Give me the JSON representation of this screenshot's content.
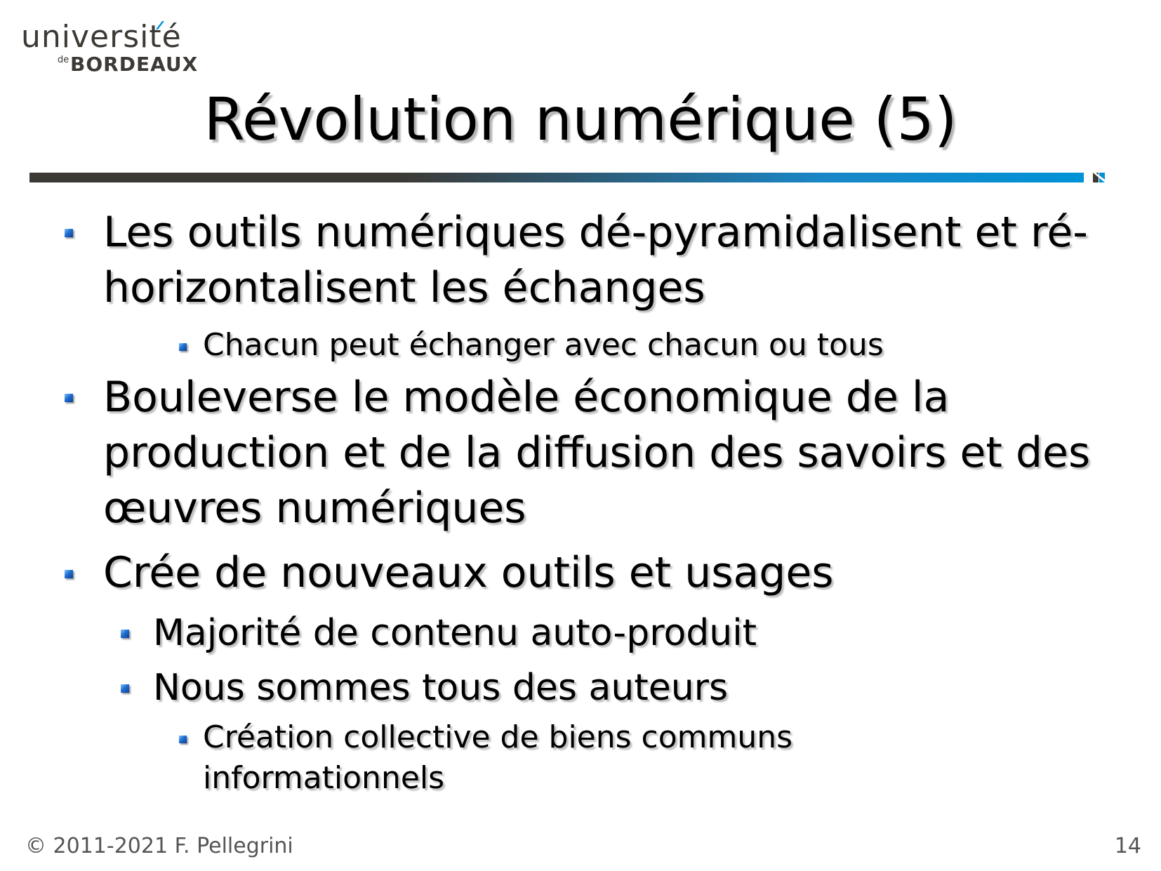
{
  "logo": {
    "line1": "université",
    "de": "de",
    "line2": "BORDEAUX"
  },
  "slide": {
    "title": "Révolution numérique (5)",
    "bullets": [
      {
        "level": 1,
        "text": "Les outils numériques dé-pyramidalisent et ré-horizontalisent les échanges"
      },
      {
        "level": 3,
        "text": "Chacun peut échanger avec chacun ou tous"
      },
      {
        "level": 1,
        "text": "Bouleverse le modèle économique de la production et de la diffusion des savoirs et des œuvres numériques"
      },
      {
        "level": 1,
        "text": "Crée de nouveaux outils et usages"
      },
      {
        "level": 2,
        "text": "Majorité de contenu auto-produit"
      },
      {
        "level": 2,
        "text": "Nous sommes tous des auteurs"
      },
      {
        "level": 3,
        "text": "Création collective de biens communs informationnels"
      }
    ]
  },
  "footer": {
    "copyright": "© 2011-2021 F. Pellegrini",
    "page_number": "14"
  },
  "colors": {
    "brand_dark": "#3d3935",
    "brand_blue": "#0092d6"
  }
}
